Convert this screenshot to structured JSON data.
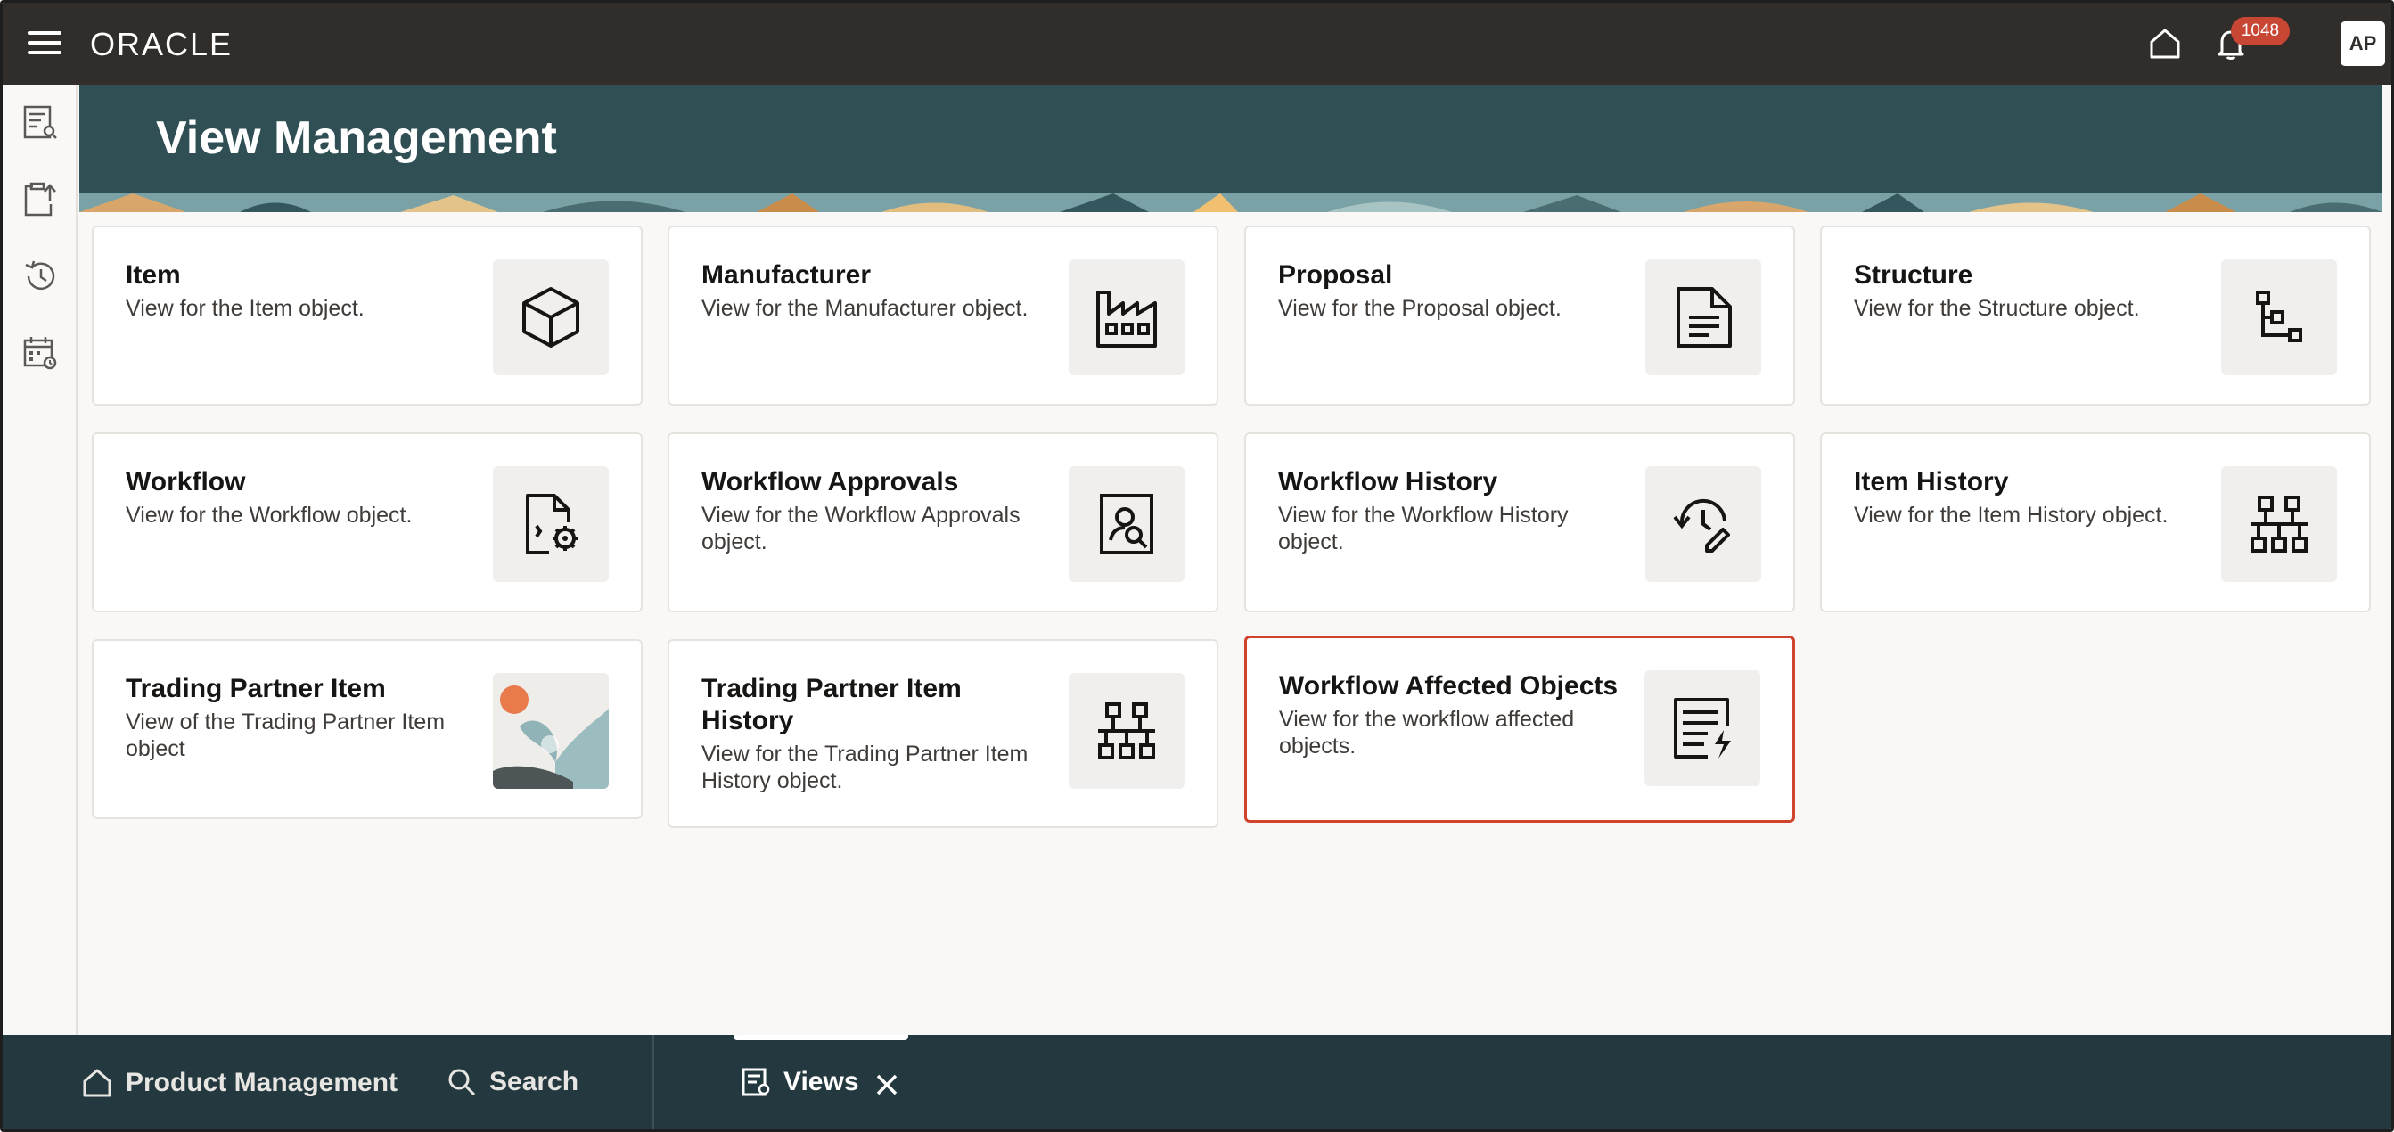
{
  "header": {
    "logo": "ORACLE",
    "notification_count": "1048",
    "avatar_initials": "AP"
  },
  "banner": {
    "title": "View Management"
  },
  "cards": [
    {
      "title": "Item",
      "description": "View for the Item object.",
      "icon": "cube-icon"
    },
    {
      "title": "Manufacturer",
      "description": "View for the Manufacturer object.",
      "icon": "factory-icon"
    },
    {
      "title": "Proposal",
      "description": "View for the Proposal object.",
      "icon": "document-icon"
    },
    {
      "title": "Structure",
      "description": "View for the Structure object.",
      "icon": "structure-tree-icon"
    },
    {
      "title": "Workflow",
      "description": "View for the Workflow object.",
      "icon": "document-gear-icon"
    },
    {
      "title": "Workflow Approvals",
      "description": "View for the Workflow Approvals object.",
      "icon": "user-search-icon"
    },
    {
      "title": "Workflow History",
      "description": "View for the Workflow History object.",
      "icon": "history-edit-icon"
    },
    {
      "title": "Item History",
      "description": "View for the Item History object.",
      "icon": "hierarchy-icon"
    },
    {
      "title": "Trading Partner Item",
      "description": "View of the Trading Partner Item object",
      "icon": "illustration-image"
    },
    {
      "title": "Trading Partner Item History",
      "description": "View for the Trading Partner Item History object.",
      "icon": "hierarchy-icon"
    },
    {
      "title": "Workflow Affected Objects",
      "description": "View for the workflow affected objects.",
      "icon": "list-bolt-icon"
    }
  ],
  "bottom_bar": {
    "home_label": "Product Management",
    "search_label": "Search",
    "active_tab_label": "Views"
  },
  "colors": {
    "topbar": "#312d2a",
    "banner": "#2f4f55",
    "bottombar": "#24393f",
    "selected_border": "#d0432d",
    "badge": "#c74634"
  }
}
